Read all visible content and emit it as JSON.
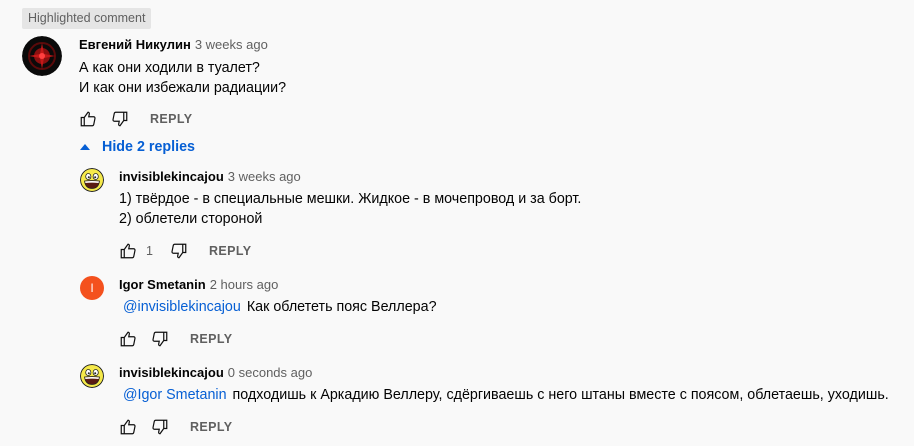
{
  "badge": "Highlighted comment",
  "main": {
    "author": "Евгений Никулин",
    "time": "3 weeks ago",
    "lines": [
      "А как они ходили в туалет?",
      "И как они избежали радиации?"
    ],
    "reply_label": "REPLY"
  },
  "toggle_label": "Hide 2 replies",
  "replies": [
    {
      "author": "invisiblekincajou",
      "time": "3 weeks ago",
      "lines": [
        "1) твёрдое - в специальные мешки. Жидкое - в мочепровод и за борт.",
        "2) облетели стороной"
      ],
      "likes": "1",
      "reply_label": "REPLY"
    },
    {
      "author": "Igor Smetanin",
      "time": "2 hours ago",
      "avatar_letter": "I",
      "avatar_color": "#f4511e",
      "mention": "@invisiblekincajou",
      "text": "Как облететь пояс Веллера?",
      "reply_label": "REPLY"
    },
    {
      "author": "invisiblekincajou",
      "time": "0 seconds ago",
      "mention": "@Igor Smetanin",
      "text": "подходишь к Аркадию Веллеру, сдёргиваешь с него штаны вместе с поясом, облетаешь, уходишь.",
      "reply_label": "REPLY"
    }
  ]
}
